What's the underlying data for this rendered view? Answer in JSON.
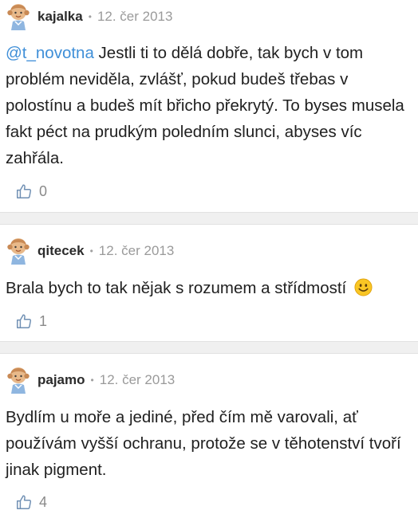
{
  "comments": [
    {
      "username": "kajalka",
      "date": "12. čer 2013",
      "mention": "@t_novotna",
      "text": " Jestli ti to dělá dobře, tak bych v tom problém neviděla, zvlášť, pokud budeš třebas v polostínu a budeš mít břicho překrytý. To byses musela fakt péct na prudkým poledním slunci, abyses víc zahřála.",
      "likes": "0",
      "avatar_icon": "girl-avatar-icon"
    },
    {
      "username": "qitecek",
      "date": "12. čer 2013",
      "text": "Brala bych to tak nějak s rozumem a střídmostí",
      "emoji": "smiley-emoji",
      "likes": "1",
      "avatar_icon": "girl-avatar-icon"
    },
    {
      "username": "pajamo",
      "date": "12. čer 2013",
      "text": "Bydlím u moře a jediné, před čím mě varovali, ať používám vyšší ochranu, protože se v těhotenství tvoří jinak pigment.",
      "likes": "4",
      "avatar_icon": "girl-avatar-icon"
    }
  ],
  "colors": {
    "mention": "#3f8fd8",
    "separator": "#f0f0f0",
    "meta": "#9a9a9a"
  }
}
